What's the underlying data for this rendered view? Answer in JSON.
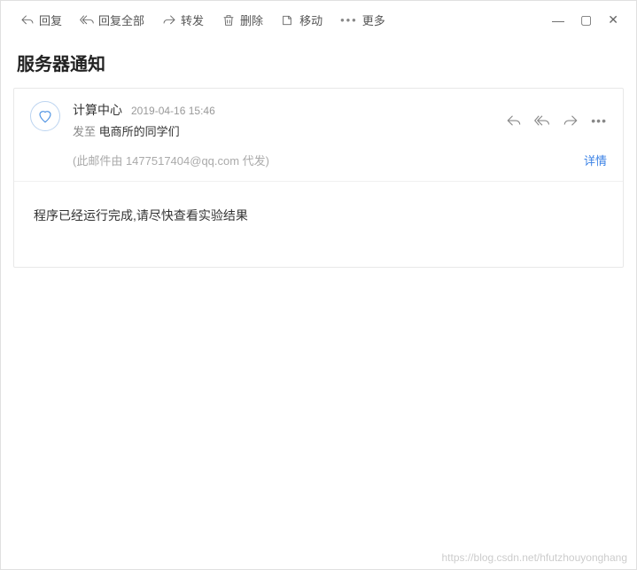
{
  "toolbar": {
    "reply": "回复",
    "reply_all": "回复全部",
    "forward": "转发",
    "delete": "删除",
    "move": "移动",
    "more": "更多"
  },
  "subject": "服务器通知",
  "sender": {
    "name": "计算中心",
    "timestamp": "2019-04-16 15:46"
  },
  "recipients": {
    "prefix": "发至",
    "list": "电商所的同学们"
  },
  "proxy_note": "(此邮件由 1477517404@qq.com 代发)",
  "detail_link": "详情",
  "body": "程序已经运行完成,请尽快查看实验结果",
  "watermark": "https://blog.csdn.net/hfutzhouyonghang"
}
